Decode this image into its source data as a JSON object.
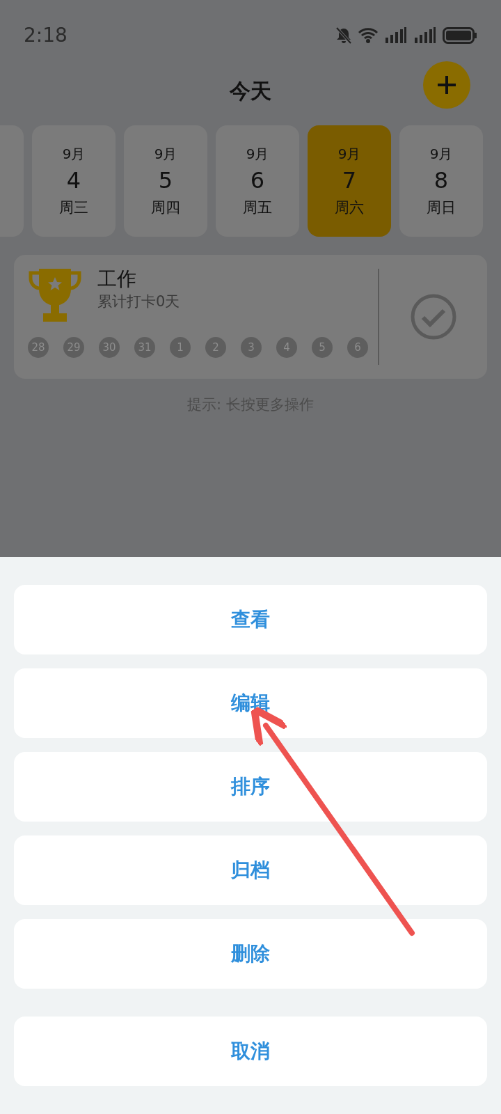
{
  "status_bar": {
    "time": "2:18"
  },
  "header": {
    "title": "今天"
  },
  "dates": [
    {
      "month": "9月",
      "day": "4",
      "weekday": "周三",
      "selected": false
    },
    {
      "month": "9月",
      "day": "5",
      "weekday": "周四",
      "selected": false
    },
    {
      "month": "9月",
      "day": "6",
      "weekday": "周五",
      "selected": false
    },
    {
      "month": "9月",
      "day": "7",
      "weekday": "周六",
      "selected": true
    },
    {
      "month": "9月",
      "day": "8",
      "weekday": "周日",
      "selected": false
    }
  ],
  "habit": {
    "name": "工作",
    "summary": "累计打卡0天",
    "days": [
      "28",
      "29",
      "30",
      "31",
      "1",
      "2",
      "3",
      "4",
      "5",
      "6"
    ]
  },
  "hint": "提示: 长按更多操作",
  "action_sheet": {
    "actions": [
      "查看",
      "编辑",
      "排序",
      "归档",
      "删除"
    ],
    "cancel": "取消"
  }
}
